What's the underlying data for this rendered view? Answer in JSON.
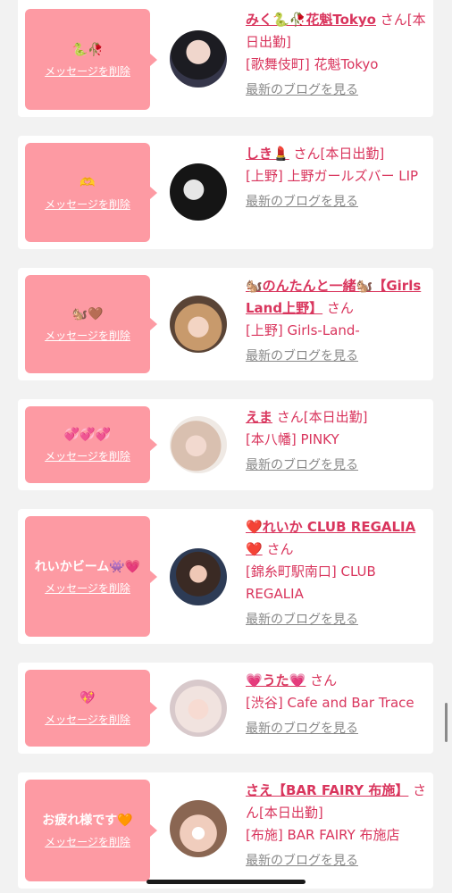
{
  "cards": [
    {
      "message": "🐍🥀",
      "delete_label": "メッセージを削除",
      "name": "みく🐍🥀花魁Tokyo",
      "san": "さん[本日出勤]",
      "shop": "[歌舞伎町] 花魁Tokyo",
      "blog_label": "最新のブログを見る"
    },
    {
      "message": "🫶",
      "delete_label": "メッセージを削除",
      "name": "しき💄",
      "san": "さん[本日出勤]",
      "shop": "[上野] 上野ガールズバー LIP",
      "blog_label": "最新のブログを見る"
    },
    {
      "message": "🐿️🤎",
      "delete_label": "メッセージを削除",
      "name": "🐿️のんたんと一緒🐿️【Girls Land上野】",
      "san": "さん",
      "shop": "[上野] Girls-Land-",
      "blog_label": "最新のブログを見る"
    },
    {
      "message": "💞💞💞",
      "delete_label": "メッセージを削除",
      "name": "えま",
      "san": "さん[本日出勤]",
      "shop": "[本八幡] PINKY",
      "blog_label": "最新のブログを見る"
    },
    {
      "message": "れいかビーム👾💗",
      "delete_label": "メッセージを削除",
      "name": "❤️れいか CLUB REGALIA❤️",
      "san": "さん",
      "shop": "[錦糸町駅南口] CLUB REGALIA",
      "blog_label": "最新のブログを見る"
    },
    {
      "message": "💖",
      "delete_label": "メッセージを削除",
      "name": "💗うた💗",
      "san": "さん",
      "shop": "[渋谷] Cafe and Bar Trace",
      "blog_label": "最新のブログを見る"
    },
    {
      "message": "お疲れ様です🧡",
      "delete_label": "メッセージを削除",
      "name": "さえ【BAR FAIRY 布施】",
      "san": "さん[本日出勤]",
      "shop": "[布施] BAR FAIRY 布施店",
      "blog_label": "最新のブログを見る"
    }
  ]
}
